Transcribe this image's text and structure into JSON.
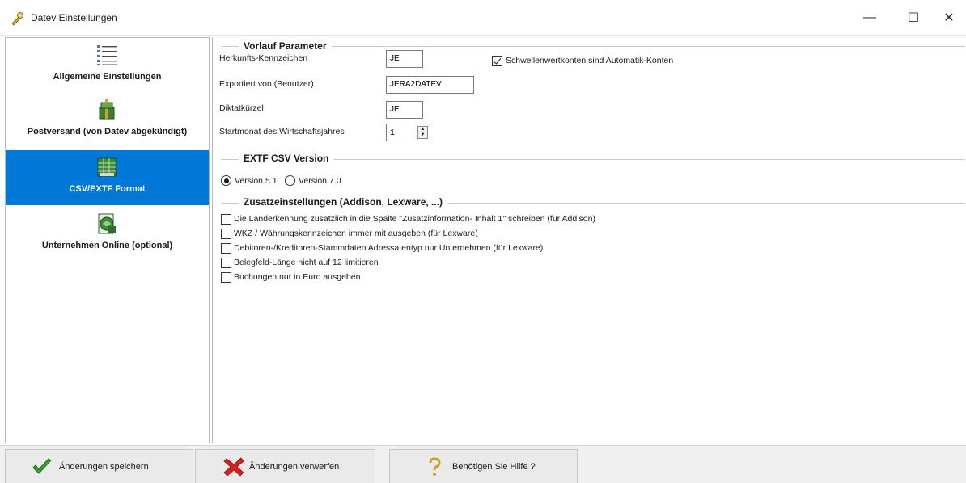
{
  "window": {
    "title": "Datev Einstellungen",
    "min_glyph": "—",
    "max_glyph": "☐",
    "close_glyph": "✕"
  },
  "sidebar": {
    "items": [
      {
        "label": "Allgemeine Einstellungen",
        "icon": "list-settings-icon",
        "selected": false
      },
      {
        "label": "Postversand (von Datev abgekündigt)",
        "icon": "mail-package-icon",
        "selected": false
      },
      {
        "label": "CSV/EXTF Format",
        "icon": "spreadsheet-icon",
        "selected": true
      },
      {
        "label": "Unternehmen Online (optional)",
        "icon": "online-document-icon",
        "selected": false
      }
    ]
  },
  "vorlauf": {
    "title": "Vorlauf Parameter",
    "herkunft_label": "Herkunfts-Kennzeichen",
    "herkunft_value": "JE",
    "exportiert_label": "Exportiert von (Benutzer)",
    "exportiert_value": "JERA2DATEV",
    "diktat_label": "Diktatkürzel",
    "diktat_value": "JE",
    "startmonat_label": "Startmonat des Wirtschaftsjahres",
    "startmonat_value": "1",
    "schwellen_label": "Schwellenwertkonten sind Automatik-Konten",
    "schwellen_checked": true
  },
  "extf": {
    "title": "EXTF CSV Version",
    "options": [
      {
        "label": "Version 5.1",
        "checked": true
      },
      {
        "label": "Version 7.0",
        "checked": false
      }
    ]
  },
  "zusatz": {
    "title": "Zusatzeinstellungen (Addison, Lexware, ...)",
    "options": [
      {
        "label": "Die Länderkennung zusätzlich in die Spalte \"Zusatzinformation- Inhalt 1\" schreiben (für Addison)",
        "checked": false
      },
      {
        "label": "WKZ / Währungskennzeichen immer mit ausgeben (für Lexware)",
        "checked": false
      },
      {
        "label": "Debitoren-/Kreditoren-Stammdaten Adressatentyp nur Unternehmen (für Lexware)",
        "checked": false
      },
      {
        "label": "Belegfeld-Länge nicht auf 12 limitieren",
        "checked": false
      },
      {
        "label": "Buchungen nur in Euro ausgeben",
        "checked": false
      }
    ]
  },
  "footer": {
    "save_label": "Änderungen speichern",
    "discard_label": "Änderungen verwerfen",
    "help_label": "Benötigen Sie Hilfe ?"
  },
  "colors": {
    "selection": "#0078d7",
    "save_check": "#3aa334",
    "discard_x": "#d42020"
  }
}
